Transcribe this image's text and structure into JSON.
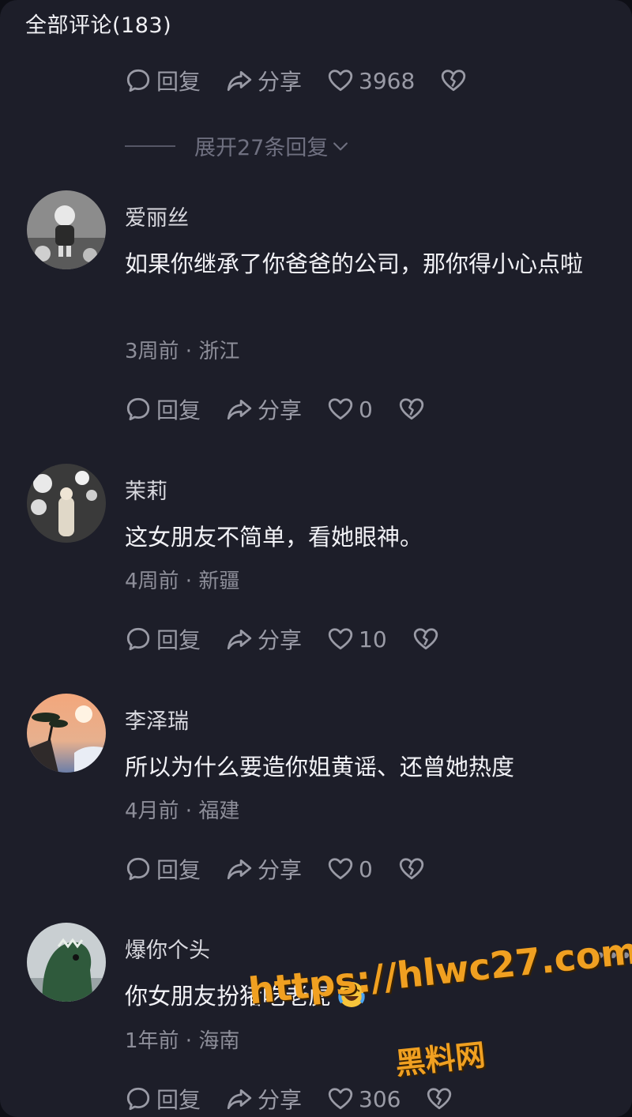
{
  "header": {
    "title": "全部评论(183)"
  },
  "top_actions": {
    "reply": "回复",
    "share": "分享",
    "likes": "3968"
  },
  "expand": {
    "label": "展开27条回复"
  },
  "comments": [
    {
      "user": "爱丽丝",
      "text": "如果你继承了你爸爸的公司，那你得小心点啦",
      "meta": "3周前 · 浙江",
      "reply": "回复",
      "share": "分享",
      "likes": "0"
    },
    {
      "user": "茉莉",
      "text": "这女朋友不简单，看她眼神。",
      "meta": "4周前 · 新疆",
      "reply": "回复",
      "share": "分享",
      "likes": "10"
    },
    {
      "user": "李泽瑞",
      "text": "所以为什么要造你姐黄谣、还曾她热度",
      "meta": "4月前 · 福建",
      "reply": "回复",
      "share": "分享",
      "likes": "0"
    },
    {
      "user": "爆你个头",
      "text": "你女朋友扮猪吃老虎",
      "meta": "1年前 · 海南",
      "reply": "回复",
      "share": "分享",
      "likes": "306"
    }
  ],
  "more_menu": "•••",
  "watermark": {
    "url": "https://hlwc27.com",
    "name": "黑料网"
  },
  "icons": [
    "comment-icon",
    "share-icon",
    "heart-icon",
    "broken-heart-icon",
    "chevron-down-icon",
    "laugh-cry-emoji"
  ]
}
